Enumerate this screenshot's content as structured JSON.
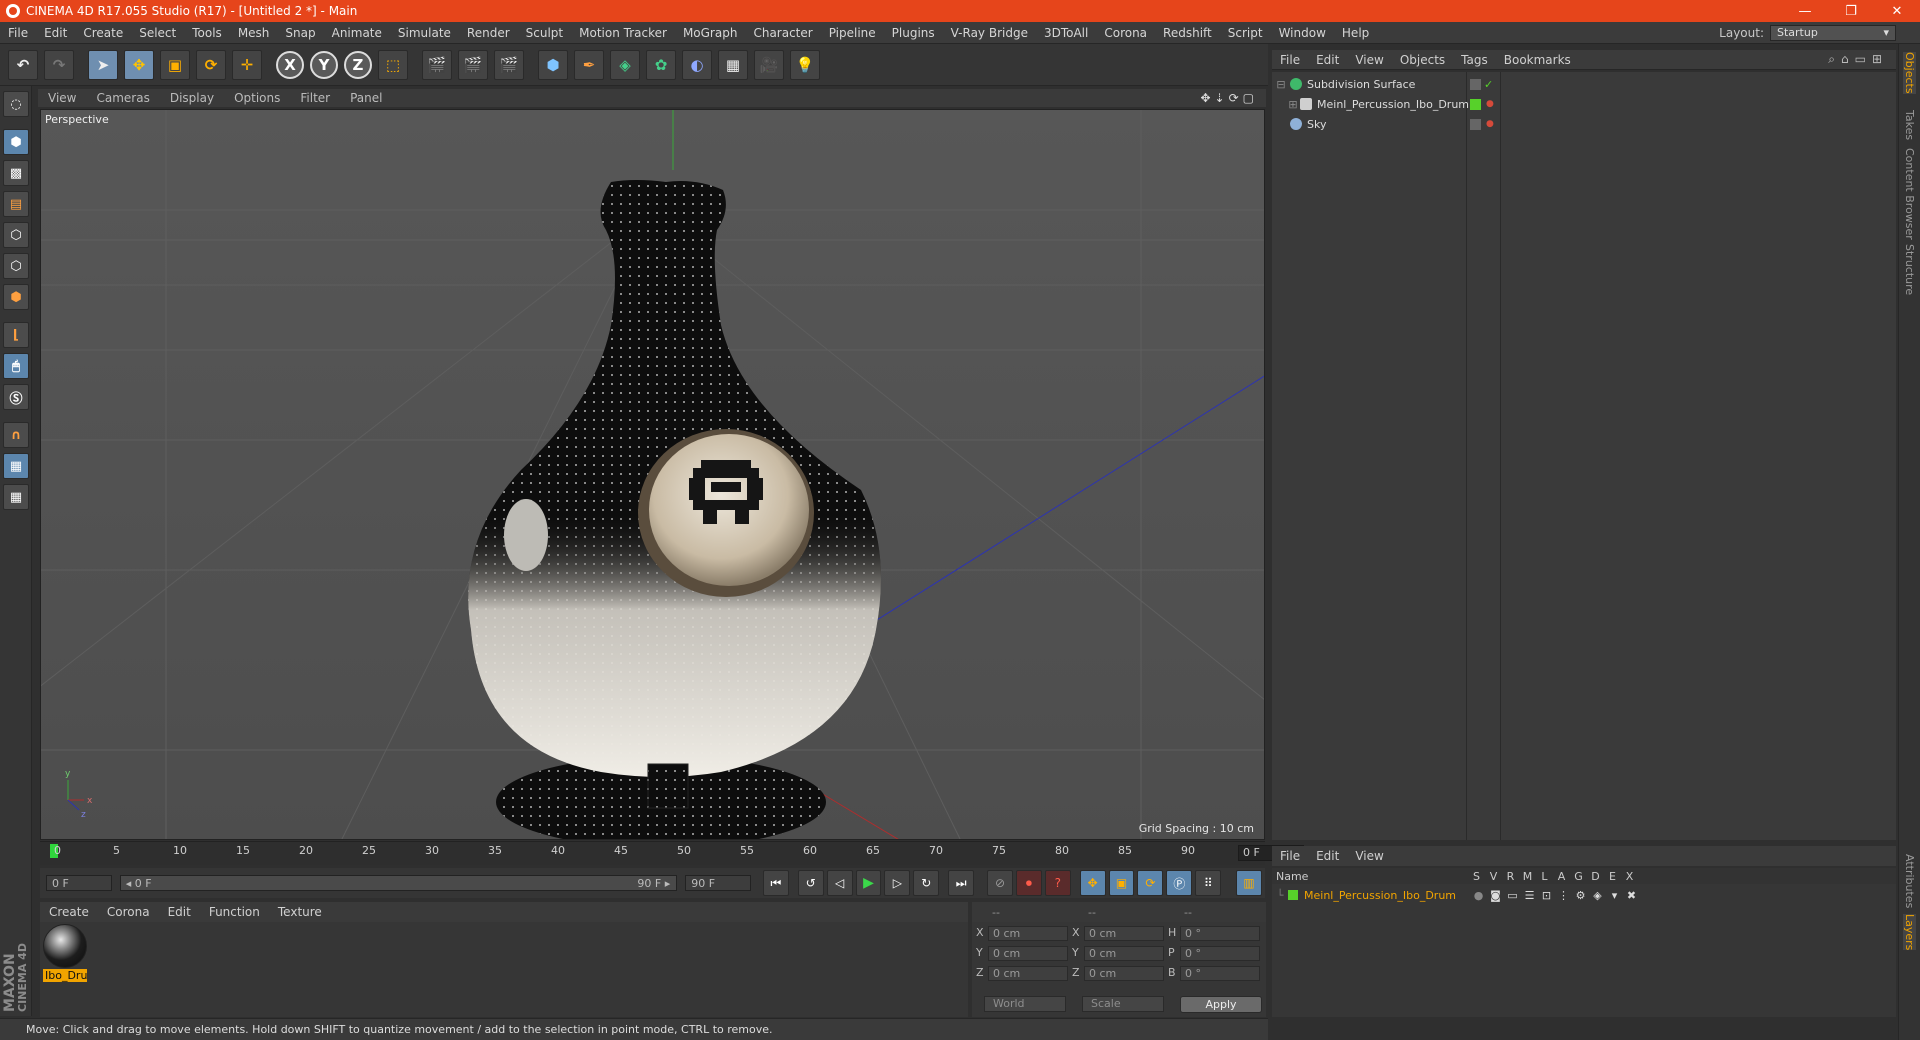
{
  "window": {
    "title": "CINEMA 4D R17.055 Studio (R17) - [Untitled 2 *] - Main",
    "minimize": "—",
    "restore": "❐",
    "close": "✕"
  },
  "menubar": {
    "items": [
      "File",
      "Edit",
      "Create",
      "Select",
      "Tools",
      "Mesh",
      "Snap",
      "Animate",
      "Simulate",
      "Render",
      "Sculpt",
      "Motion Tracker",
      "MoGraph",
      "Character",
      "Pipeline",
      "Plugins",
      "V-Ray Bridge",
      "3DToAll",
      "Corona",
      "Redshift",
      "Script",
      "Window",
      "Help"
    ],
    "layout_label": "Layout:",
    "layout_value": "Startup"
  },
  "viewport": {
    "menu": [
      "View",
      "Cameras",
      "Display",
      "Options",
      "Filter",
      "Panel"
    ],
    "camera_label": "Perspective",
    "grid_spacing": "Grid Spacing : 10 cm"
  },
  "timeline": {
    "ticks": [
      "0",
      "5",
      "10",
      "15",
      "20",
      "25",
      "30",
      "35",
      "40",
      "45",
      "50",
      "55",
      "60",
      "65",
      "70",
      "75",
      "80",
      "85",
      "90"
    ],
    "current_frame": "0 F"
  },
  "transport": {
    "start_field": "0 F",
    "range_start": "◂ 0 F",
    "range_end": "90 F ▸",
    "end_field": "90 F"
  },
  "material_manager": {
    "menu": [
      "Create",
      "Corona",
      "Edit",
      "Function",
      "Texture"
    ],
    "materials": [
      {
        "name": "Ibo_Dru"
      }
    ]
  },
  "brand": {
    "line1": "MAXON",
    "line2": "CINEMA 4D"
  },
  "coordinates": {
    "headers": [
      "--",
      "--",
      "--"
    ],
    "rows": [
      {
        "a": "X",
        "av": "0 cm",
        "b": "X",
        "bv": "0 cm",
        "c": "H",
        "cv": "0 °"
      },
      {
        "a": "Y",
        "av": "0 cm",
        "b": "Y",
        "bv": "0 cm",
        "c": "P",
        "cv": "0 °"
      },
      {
        "a": "Z",
        "av": "0 cm",
        "b": "Z",
        "bv": "0 cm",
        "c": "B",
        "cv": "0 °"
      }
    ],
    "mode": "World",
    "type": "Scale",
    "apply": "Apply"
  },
  "status_text": "Move: Click and drag to move elements. Hold down SHIFT to quantize movement / add to the selection in point mode, CTRL to remove.",
  "object_manager": {
    "menu": [
      "File",
      "Edit",
      "View",
      "Objects",
      "Tags",
      "Bookmarks"
    ],
    "objects": [
      {
        "name": "Subdivision Surface",
        "icon_color": "#3fb96a"
      },
      {
        "name": "Meinl_Percussion_Ibo_Drum",
        "icon_color": "#cfcfcf"
      },
      {
        "name": "Sky",
        "icon_color": "#8fb1d8"
      }
    ]
  },
  "layer_manager": {
    "menu": [
      "File",
      "Edit",
      "View"
    ],
    "columns": [
      "Name",
      "S",
      "V",
      "R",
      "M",
      "L",
      "A",
      "G",
      "D",
      "E",
      "X"
    ],
    "layers": [
      {
        "name": "Meinl_Percussion_Ibo_Drum",
        "color": "#57d12a"
      }
    ]
  },
  "right_tabs": [
    "Objects",
    "Takes",
    "Content Browser",
    "Structure",
    "Attributes",
    "Layers"
  ],
  "colors": {
    "accent": "#e6451b",
    "selection_orange": "#f1a400",
    "layer_green": "#57d12a"
  }
}
